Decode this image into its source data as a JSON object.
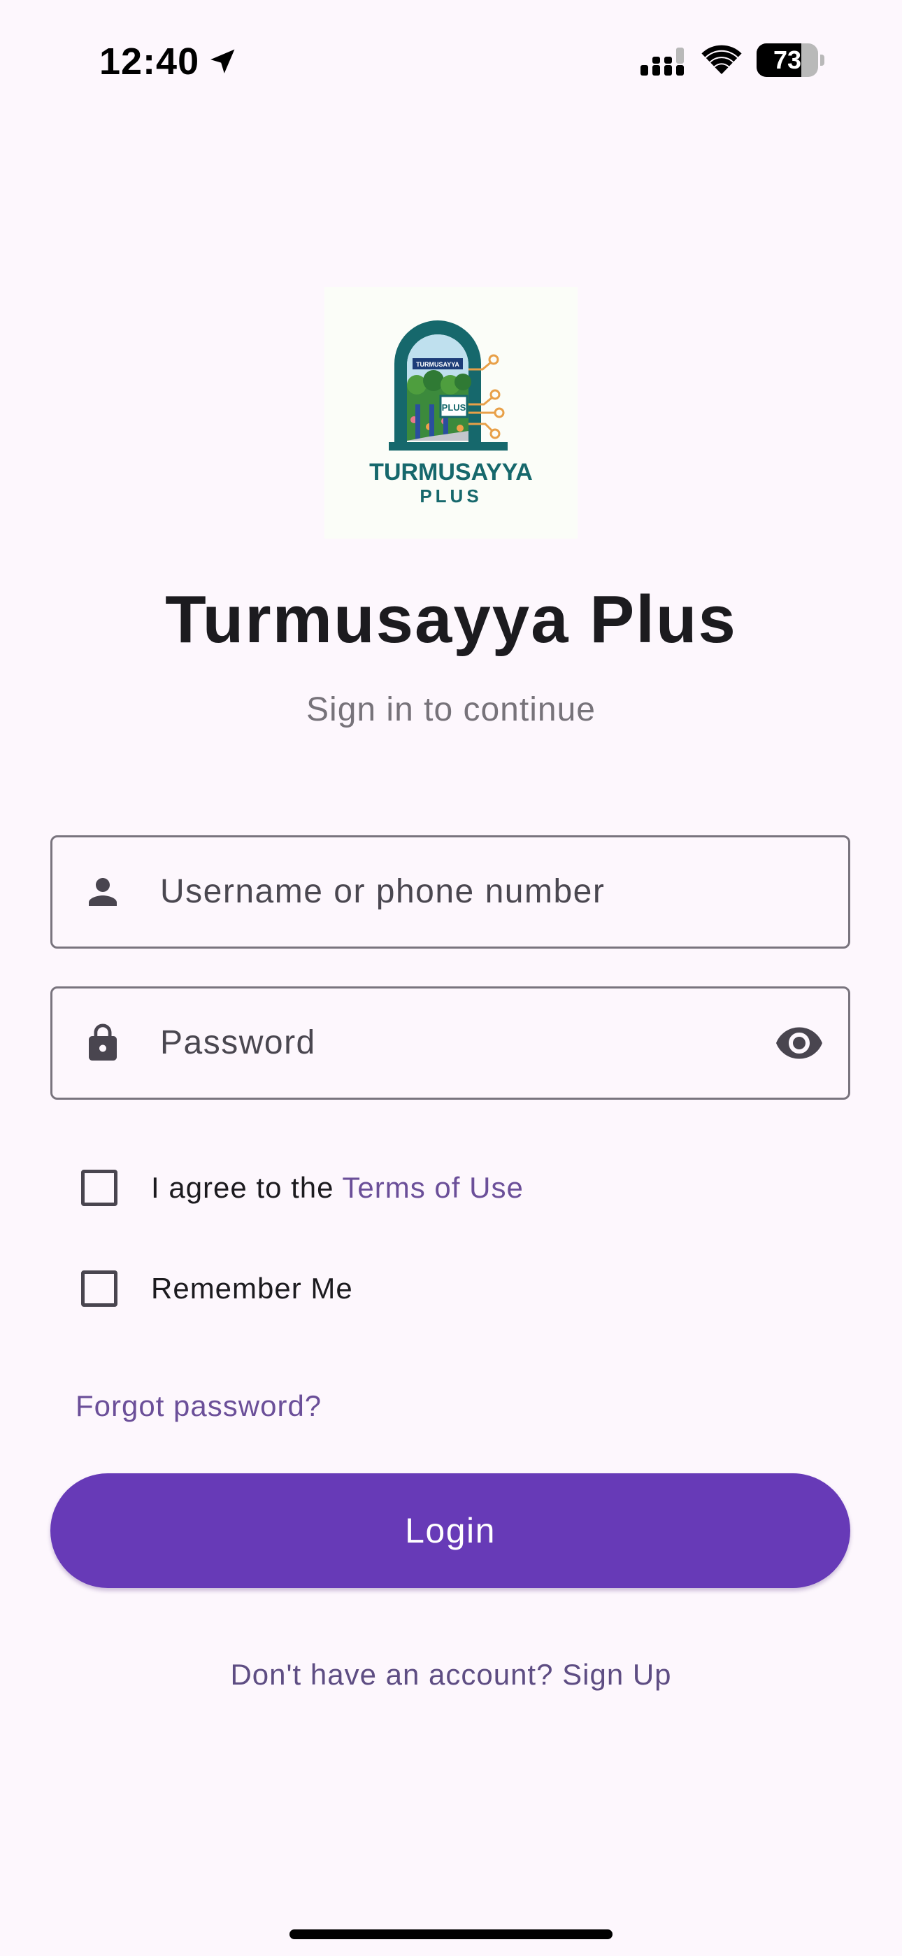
{
  "status_bar": {
    "time": "12:40",
    "battery_level": "73",
    "battery_fraction": 0.73,
    "icons": [
      "location-arrow-icon",
      "cellular-signal-icon",
      "wifi-icon",
      "battery-icon"
    ]
  },
  "logo": {
    "banner_text": "TURMUSAYYA",
    "badge_text": "PLUS",
    "wordmark": "TURMUSAYYA",
    "sub_wordmark": "PLUS",
    "colors": {
      "teal": "#16686c",
      "orange": "#e8a048",
      "navy": "#1d3d78"
    }
  },
  "header": {
    "title": "Turmusayya Plus",
    "subtitle": "Sign in to continue"
  },
  "form": {
    "username": {
      "placeholder": "Username or phone number",
      "value": "",
      "icon": "person-icon"
    },
    "password": {
      "placeholder": "Password",
      "value": "",
      "icon": "lock-icon",
      "toggle_icon": "eye-icon"
    },
    "terms": {
      "label_prefix": "I agree to the ",
      "link_text": "Terms of Use",
      "checked": false
    },
    "remember": {
      "label": "Remember Me",
      "checked": false
    },
    "forgot_password": "Forgot password?",
    "login_label": "Login",
    "signup_text": "Don't have an account? Sign Up"
  },
  "colors": {
    "background": "#fdf7fd",
    "primary": "#673ab7",
    "link": "#6b4f99",
    "outline": "#79747e"
  }
}
